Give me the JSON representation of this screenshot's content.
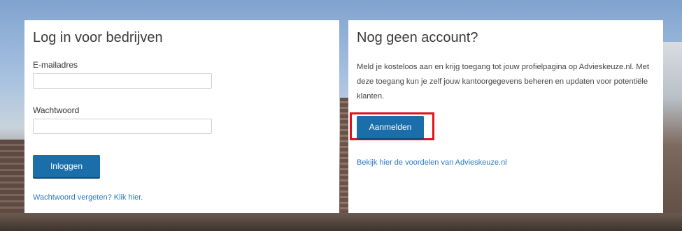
{
  "login": {
    "title": "Log in voor bedrijven",
    "email_label": "E-mailadres",
    "email_value": "",
    "password_label": "Wachtwoord",
    "password_value": "",
    "login_button": "Inloggen",
    "forgot_link": "Wachtwoord vergeten? Klik hier."
  },
  "register": {
    "title": "Nog geen account?",
    "description": "Meld je kosteloos aan en krijg toegang tot jouw profielpagina op Advieskeuze.nl. Met deze toegang kun je zelf jouw kantoorgegevens beheren en updaten voor potentiële klanten.",
    "register_button": "Aanmelden",
    "advantages_link": "Bekijk hier de voordelen van Advieskeuze.nl"
  },
  "colors": {
    "button_blue": "#1a6eaa",
    "link_blue": "#2a7ac4",
    "highlight_red": "#e0121b"
  }
}
